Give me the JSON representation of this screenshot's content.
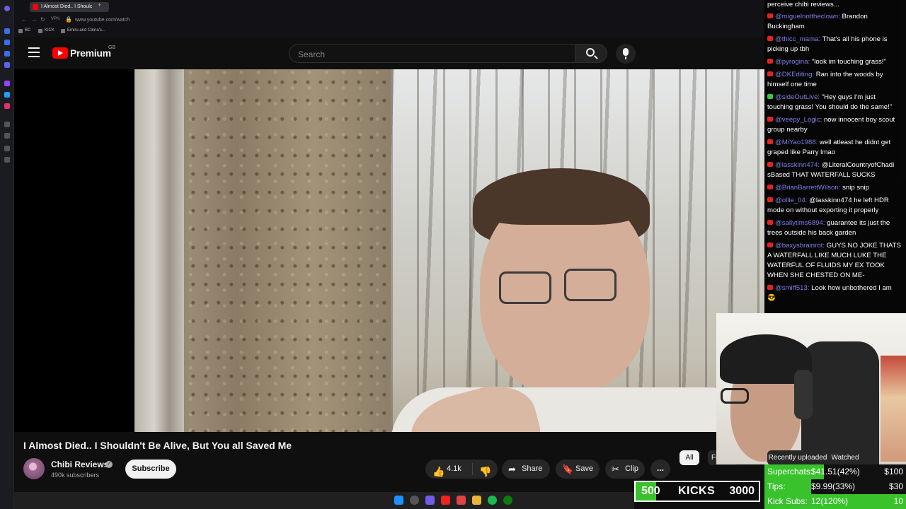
{
  "browser": {
    "tab_title": "I Almost Died.. I Shoulc",
    "url": "www.youtube.com/watch",
    "bookmarks": [
      "BC",
      "KICK",
      "Emiru and Cinna's..."
    ]
  },
  "youtube": {
    "brand": "Premium",
    "region": "GB",
    "search_placeholder": "Search"
  },
  "video": {
    "title": "I Almost Died.. I Shouldn't Be Alive, But You all Saved Me",
    "channel": "Chibi Reviews",
    "subscribers": "490k subscribers",
    "subscribe_label": "Subscribe",
    "likes": "4.1k",
    "share_label": "Share",
    "save_label": "Save",
    "clip_label": "Clip",
    "more_label": "..."
  },
  "chips": [
    "All",
    "For you",
    "Recently uploaded",
    "Watched"
  ],
  "chat": [
    {
      "user": "",
      "text": "perceive chibi reviews...",
      "badge": "none"
    },
    {
      "user": "@miguelnottheclown:",
      "text": "Brandon Buckingham",
      "badge": "red"
    },
    {
      "user": "@thicc_mama:",
      "text": "That's all his phone is picking up tbh",
      "badge": "red"
    },
    {
      "user": "@pyrogina:",
      "text": "\"look im touching grass!\"",
      "badge": "red"
    },
    {
      "user": "@DKEditing:",
      "text": "Ran into the woods by himself one time",
      "badge": "red"
    },
    {
      "user": "@sideOutLive:",
      "text": "\"Hey guys I'm just touching grass! You should do the same!\"",
      "badge": "green"
    },
    {
      "user": "@veepy_Logic:",
      "text": "now innocent boy scout group nearby",
      "badge": "red"
    },
    {
      "user": "@MiYao1988:",
      "text": "well atleast he didnt get graped like Parry lmao",
      "badge": "red"
    },
    {
      "user": "@lasskinn474:",
      "text": "@LiteralCountryofChadi sBased THAT WATERFALL SUCKS",
      "badge": "red"
    },
    {
      "user": "@BrianBarrettWilson:",
      "text": "snip snip",
      "badge": "red"
    },
    {
      "user": "@ollie_04:",
      "text": "@lasskinn474 he left HDR mode on without exporting it properly",
      "badge": "red"
    },
    {
      "user": "@sallytims6894:",
      "text": "guarantee its just the trees outside his back garden",
      "badge": "red"
    },
    {
      "user": "@baxysbrainrot:",
      "text": "GUYS NO JOKE THATS A WATERFALL LIKE MUCH LUKE THE WATERFUL OF FLUIDS MY EX TOOK WHEN SHE CHESTED ON ME-",
      "badge": "red"
    },
    {
      "user": "@smiff513:",
      "text": "Look how unbothered I am 😎",
      "badge": "red"
    }
  ],
  "donations": [
    {
      "label": "Superchats:",
      "value": "$41.51(42%)",
      "goal": "$100",
      "fraction": 0.42
    },
    {
      "label": "Tips:",
      "value": "$9.99(33%)",
      "goal": "$30",
      "fraction": 0.33
    },
    {
      "label": "Kick Subs:",
      "value": "12(120%)",
      "goal": "10",
      "fraction": 1.0
    }
  ],
  "kicks": {
    "current": "500",
    "label": "KICKS",
    "goal": "3000",
    "fraction": 0.1667
  },
  "colors": {
    "accent_green": "#39c22c",
    "youtube_red": "#ff0000",
    "chat_user": "#7e7ee8"
  }
}
